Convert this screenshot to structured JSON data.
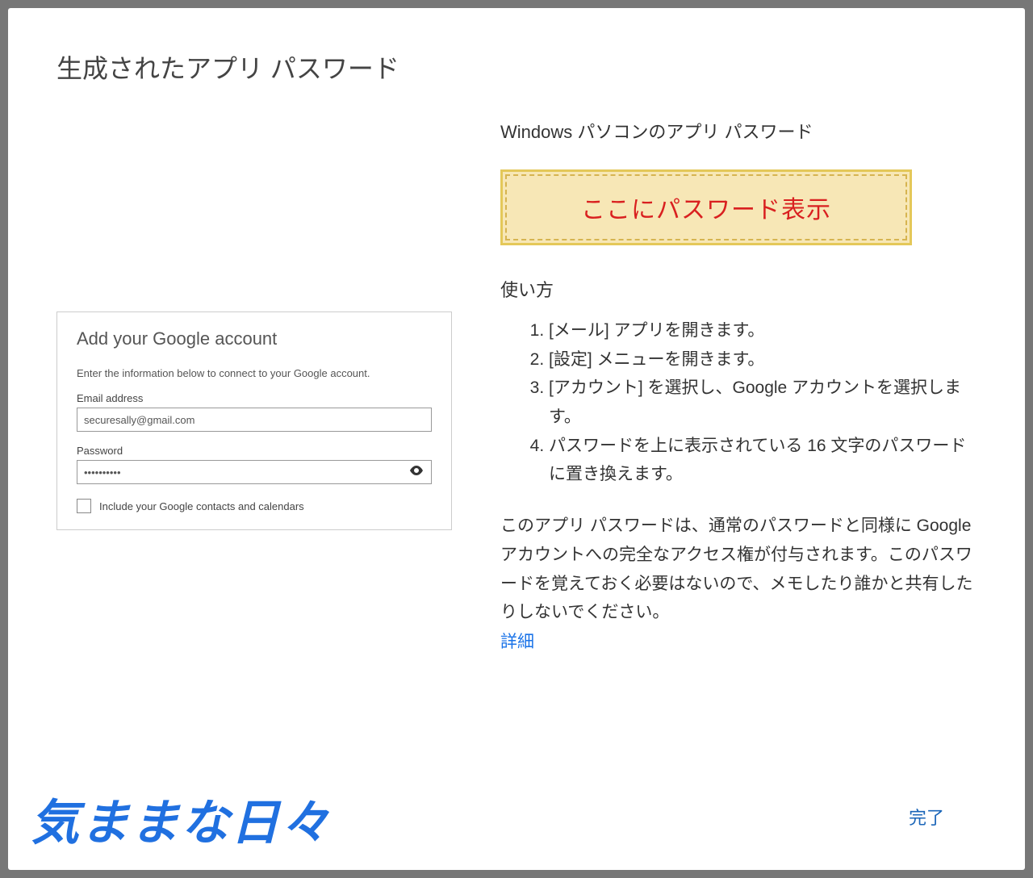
{
  "header": {
    "title": "生成されたアプリ パスワード"
  },
  "left": {
    "card_title": "Add your Google account",
    "card_sub": "Enter the information below to connect to your Google account.",
    "email_label": "Email address",
    "email_value": "securesally@gmail.com",
    "password_label": "Password",
    "password_value": "••••••••••",
    "checkbox_label": "Include your Google contacts and calendars"
  },
  "right": {
    "subheading": "Windows パソコンのアプリ パスワード",
    "password_display": "ここにパスワード表示",
    "usage_title": "使い方",
    "steps": [
      "[メール] アプリを開きます。",
      "[設定] メニューを開きます。",
      "[アカウント] を選択し、Google アカウントを選択します。",
      "パスワードを上に表示されている 16 文字のパスワードに置き換えます。"
    ],
    "note": "このアプリ パスワードは、通常のパスワードと同様に Google アカウントへの完全なアクセス権が付与されます。このパスワードを覚えておく必要はないので、メモしたり誰かと共有したりしないでください。",
    "detail_link": "詳細",
    "done_label": "完了"
  },
  "watermark": "気ままな日々"
}
